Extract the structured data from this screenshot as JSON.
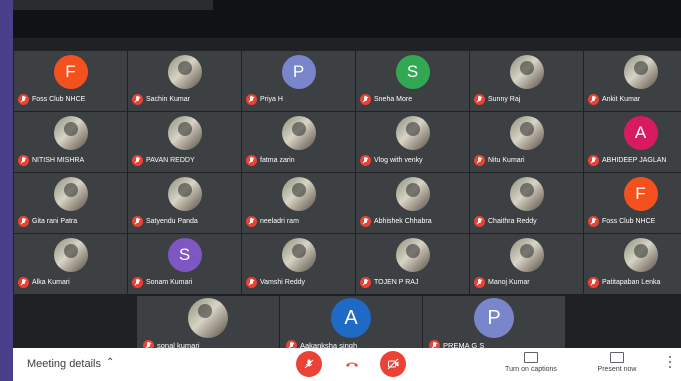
{
  "participants": [
    {
      "name": "Foss Club NHCE",
      "initial": "F",
      "color": "#f4511e"
    },
    {
      "name": "Sachin Kumar",
      "initial": "",
      "color": ""
    },
    {
      "name": "Priya H",
      "initial": "P",
      "color": "#7986cb"
    },
    {
      "name": "Sneha More",
      "initial": "S",
      "color": "#33a852"
    },
    {
      "name": "Sunny Raj",
      "initial": "",
      "color": ""
    },
    {
      "name": "Ankit Kumar",
      "initial": "",
      "color": ""
    },
    {
      "name": "NITISH MISHRA",
      "initial": "",
      "color": ""
    },
    {
      "name": "PAVAN REDDY",
      "initial": "",
      "color": ""
    },
    {
      "name": "fatma zarin",
      "initial": "",
      "color": ""
    },
    {
      "name": "Vlog with venky",
      "initial": "",
      "color": ""
    },
    {
      "name": "Nitu Kumari",
      "initial": "",
      "color": ""
    },
    {
      "name": "ABHIDEEP JAGLAN",
      "initial": "A",
      "color": "#d81b60"
    },
    {
      "name": "Gita rani Patra",
      "initial": "",
      "color": ""
    },
    {
      "name": "Satyendu Panda",
      "initial": "",
      "color": ""
    },
    {
      "name": "neeladri ram",
      "initial": "",
      "color": ""
    },
    {
      "name": "Abhishek Chhabra",
      "initial": "",
      "color": ""
    },
    {
      "name": "Chaithra Reddy",
      "initial": "",
      "color": ""
    },
    {
      "name": "Foss Club NHCE",
      "initial": "F",
      "color": "#f4511e"
    },
    {
      "name": "Alka Kumari",
      "initial": "",
      "color": ""
    },
    {
      "name": "Sonam Kumari",
      "initial": "S",
      "color": "#7e57c2"
    },
    {
      "name": "Vamshi Reddy",
      "initial": "",
      "color": ""
    },
    {
      "name": "TOJEN P RAJ",
      "initial": "",
      "color": ""
    },
    {
      "name": "Manoj Kumar",
      "initial": "",
      "color": ""
    },
    {
      "name": "Patitapaban Lenka",
      "initial": "",
      "color": ""
    }
  ],
  "bottom_participants": [
    {
      "name": "sonal kumari",
      "initial": "",
      "color": ""
    },
    {
      "name": "Aakanksha singh",
      "initial": "A",
      "color": "#1e6ac6"
    },
    {
      "name": "PREMA G S",
      "initial": "P",
      "color": "#7986cb"
    }
  ],
  "bottombar": {
    "meeting_details": "Meeting details",
    "captions_label": "Turn on captions",
    "present_label": "Present now"
  },
  "icons": {
    "muted_mic": "mic-off-icon",
    "hang_up": "phone-hangup-icon",
    "camera_off": "camera-off-icon",
    "captions": "captions-icon",
    "present": "present-icon",
    "more": "more-vertical-icon"
  },
  "colors": {
    "muted": "#ea4335",
    "tile_bg": "#3c4043",
    "frame_bg": "#202124"
  }
}
